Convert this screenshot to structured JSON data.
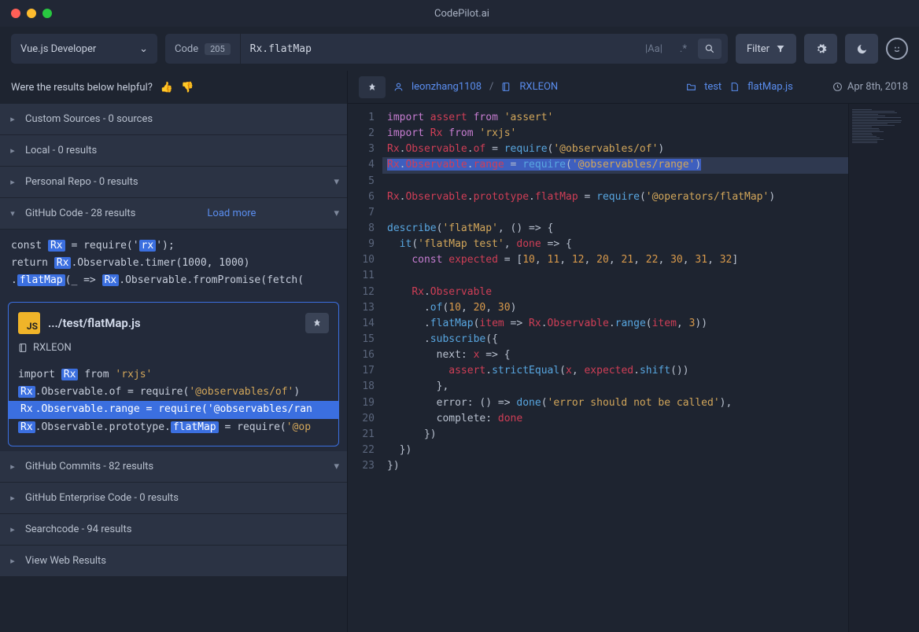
{
  "title": "CodePilot.ai",
  "toolbar": {
    "profile": "Vue.js Developer",
    "code_label": "Code",
    "code_count": "205",
    "search_value": "Rx.flatMap",
    "aa": "|Aa|",
    "regex": ".*",
    "filter_label": "Filter"
  },
  "sidebar": {
    "helpful": "Were the results below helpful?",
    "sections": {
      "custom": "Custom Sources - 0 sources",
      "local": "Local - 0 results",
      "personal": "Personal Repo - 0 results",
      "github_code": "GitHub Code - 28 results",
      "load_more": "Load more",
      "github_commits": "GitHub Commits - 82 results",
      "enterprise": "GitHub Enterprise Code - 0 results",
      "searchcode": "Searchcode - 94 results",
      "view_web": "View Web Results"
    },
    "snippet1": {
      "l1a": "const ",
      "l1b": "Rx",
      "l1c": " = require('",
      "l1d": "rx",
      "l1e": "');",
      "l2a": "return ",
      "l2b": "Rx",
      "l2c": ".Observable.timer(1000, 1000)",
      "l3a": ".",
      "l3b": "flatMap",
      "l3c": "(_ => ",
      "l3d": "Rx",
      "l3e": ".Observable.fromPromise(fetch("
    },
    "card": {
      "js": "JS",
      "path": ".../test/flatMap.js",
      "repo": "RXLEON",
      "l1a": "import ",
      "l1b": "Rx",
      "l1c": " from ",
      "l1d": "'rxjs'",
      "l2a": "Rx",
      "l2b": ".Observable.of = require(",
      "l2c": "'@observables/of'",
      "l2d": ")",
      "l3a": "Rx",
      "l3b": ".Observable.range = require(",
      "l3c": "'@observables/ran",
      "l4a": "Rx",
      "l4b": ".Observable.prototype.",
      "l4c": "flatMap",
      "l4d": " = require(",
      "l4e": "'@op"
    }
  },
  "viewer": {
    "user": "leonzhang1108",
    "repo": "RXLEON",
    "folder": "test",
    "file": "flatMap.js",
    "date": "Apr 8th, 2018",
    "lines": [
      "1",
      "2",
      "3",
      "4",
      "5",
      "6",
      "7",
      "8",
      "9",
      "10",
      "11",
      "12",
      "13",
      "14",
      "15",
      "16",
      "17",
      "18",
      "19",
      "20",
      "21",
      "22",
      "23"
    ],
    "code": {
      "l1": [
        "import ",
        "assert",
        " from ",
        "'assert'"
      ],
      "l2": [
        "import ",
        "Rx",
        " from ",
        "'rxjs'"
      ],
      "l3": [
        "Rx",
        ".",
        "Observable",
        ".",
        "of",
        " = ",
        "require",
        "(",
        "'@observables/of'",
        ")"
      ],
      "l4": [
        "Rx",
        ".",
        "Observable",
        ".",
        "range",
        " = ",
        "require",
        "(",
        "'@observables/range'",
        ")"
      ],
      "l5": [
        "Rx",
        ".",
        "Observable",
        ".",
        "prototype",
        ".",
        "flatMap",
        " = ",
        "require",
        "(",
        "'@operators/flatMap'",
        ")"
      ],
      "l7": [
        "describe",
        "(",
        "'flatMap'",
        ", () => {"
      ],
      "l8": [
        "  ",
        "it",
        "(",
        "'flatMap test'",
        ", ",
        "done",
        " => {"
      ],
      "l9": [
        "    ",
        "const ",
        "expected",
        " = [",
        "10",
        ", ",
        "11",
        ", ",
        "12",
        ", ",
        "20",
        ", ",
        "21",
        ", ",
        "22",
        ", ",
        "30",
        ", ",
        "31",
        ", ",
        "32",
        "]"
      ],
      "l11": [
        "    ",
        "Rx",
        ".",
        "Observable"
      ],
      "l12": [
        "      .",
        "of",
        "(",
        "10",
        ", ",
        "20",
        ", ",
        "30",
        ")"
      ],
      "l13": [
        "      .",
        "flatMap",
        "(",
        "item",
        " => ",
        "Rx",
        ".",
        "Observable",
        ".",
        "range",
        "(",
        "item",
        ", ",
        "3",
        "))"
      ],
      "l14": [
        "      .",
        "subscribe",
        "({"
      ],
      "l15": [
        "        next: ",
        "x",
        " => {"
      ],
      "l16": [
        "          ",
        "assert",
        ".",
        "strictEqual",
        "(",
        "x",
        ", ",
        "expected",
        ".",
        "shift",
        "())"
      ],
      "l17": [
        "        },"
      ],
      "l18": [
        "        error: () => ",
        "done",
        "(",
        "'error should not be called'",
        "),"
      ],
      "l19": [
        "        complete: ",
        "done"
      ],
      "l20": [
        "      })"
      ],
      "l21": [
        "  })"
      ],
      "l22": [
        "})"
      ]
    }
  }
}
